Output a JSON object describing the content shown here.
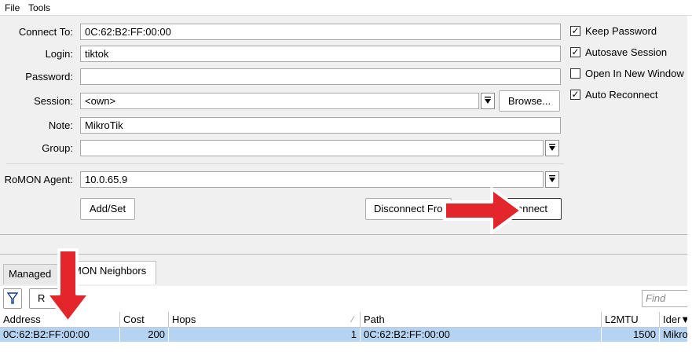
{
  "menu": {
    "file": "File",
    "tools": "Tools"
  },
  "form": {
    "connect_to_label": "Connect To:",
    "connect_to_value": "0C:62:B2:FF:00:00",
    "login_label": "Login:",
    "login_value": "tiktok",
    "password_label": "Password:",
    "password_value": "",
    "session_label": "Session:",
    "session_value": "<own>",
    "browse_label": "Browse...",
    "note_label": "Note:",
    "note_value": "MikroTik",
    "group_label": "Group:",
    "group_value": "",
    "romon_agent_label": "RoMON Agent:",
    "romon_agent_value": "10.0.65.9",
    "add_set_label": "Add/Set",
    "disconnect_label": "Disconnect Fro",
    "connect_label": "onnect"
  },
  "options": [
    {
      "label": "Keep Password",
      "checked": true
    },
    {
      "label": "Autosave Session",
      "checked": true
    },
    {
      "label": "Open In New Window",
      "checked": false
    },
    {
      "label": "Auto Reconnect",
      "checked": true
    }
  ],
  "tabs": [
    {
      "label": "Managed"
    },
    {
      "label": "MON Neighbors"
    }
  ],
  "toolbar": {
    "refresh_label": "R",
    "find_placeholder": "Find"
  },
  "table": {
    "columns": [
      "Address",
      "Cost",
      "Hops",
      "Path",
      "L2MTU",
      "Ider"
    ],
    "rows": [
      {
        "address": "0C:62:B2:FF:00:00",
        "cost": "200",
        "hops": "1",
        "path": "0C:62:B2:FF:00:00",
        "l2mtu": "1500",
        "identity": "MikroT"
      }
    ]
  },
  "annotations": {
    "arrow_color": "#e3262b",
    "arrows": [
      "right-arrow-to-connect",
      "down-arrow-to-address"
    ]
  }
}
